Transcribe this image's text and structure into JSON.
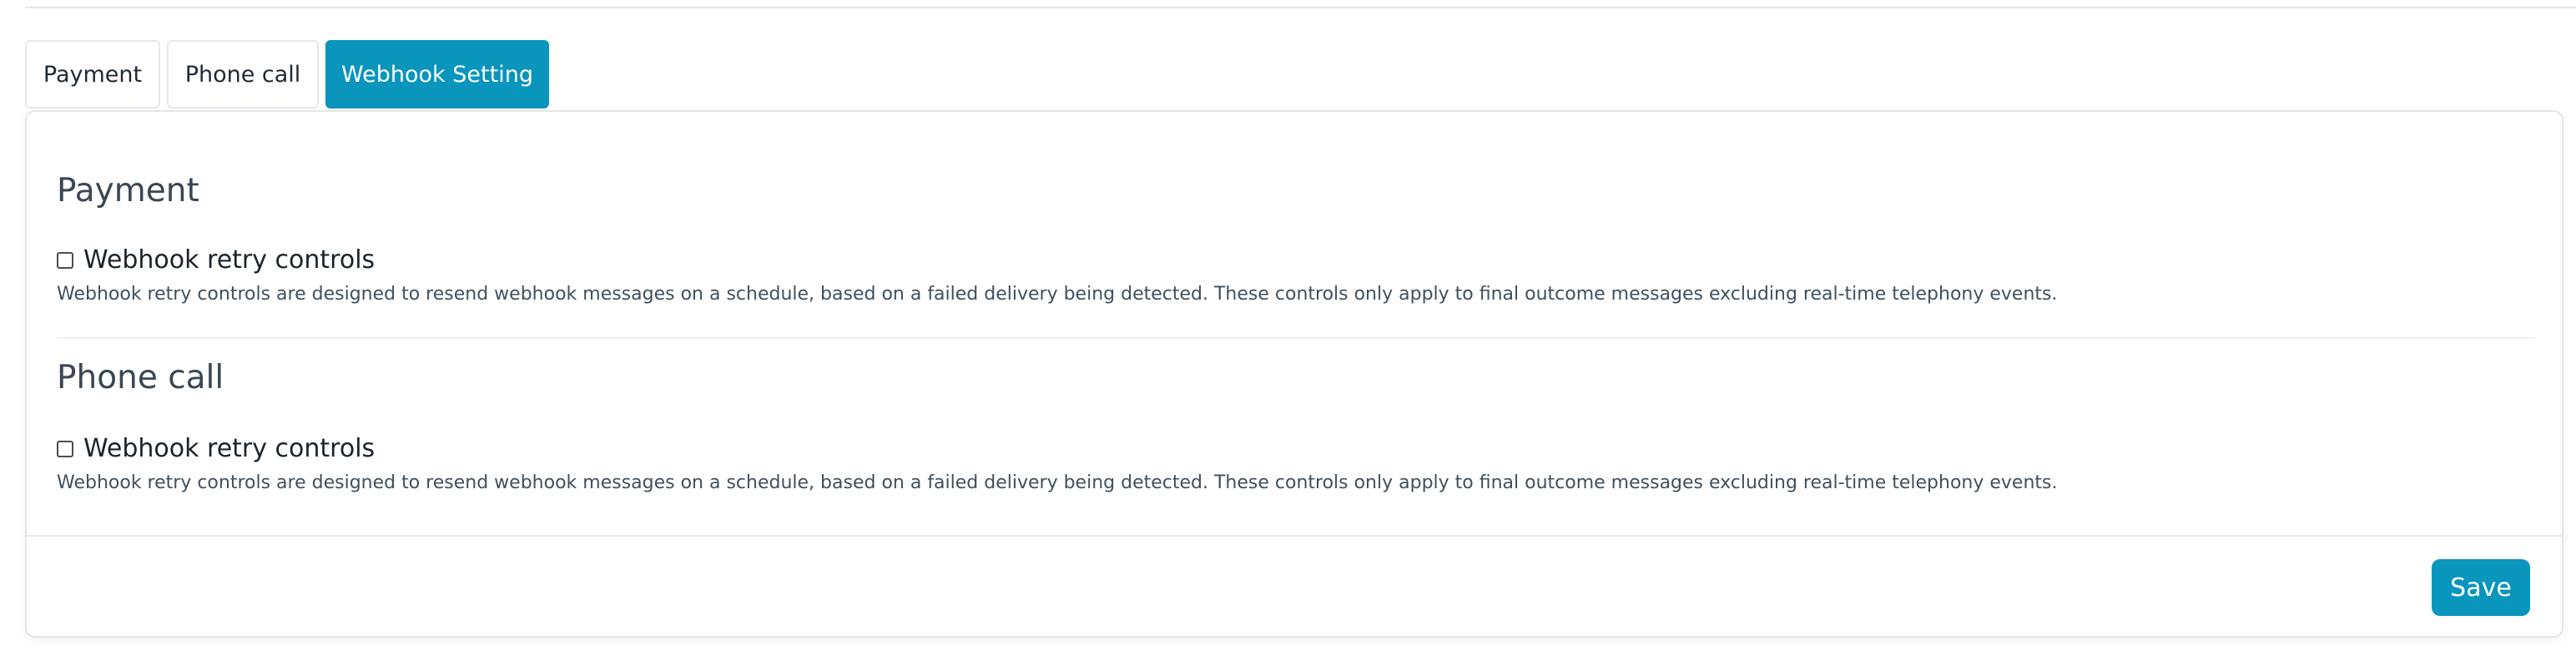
{
  "tabs": [
    {
      "label": "Payment"
    },
    {
      "label": "Phone call"
    },
    {
      "label": "Webhook Setting"
    }
  ],
  "active_tab": "Webhook Setting",
  "sections": [
    {
      "title": "Payment",
      "checkbox_label": "Webhook retry controls",
      "checked": false,
      "description": "Webhook retry controls are designed to resend webhook messages on a schedule, based on a failed delivery being detected. These controls only apply to final outcome messages excluding real-time telephony events."
    },
    {
      "title": "Phone call",
      "checkbox_label": "Webhook retry controls",
      "checked": false,
      "description": "Webhook retry controls are designed to resend webhook messages on a schedule, based on a failed delivery being detected. These controls only apply to final outcome messages excluding real-time telephony events."
    }
  ],
  "footer": {
    "save_label": "Save"
  },
  "colors": {
    "accent": "#0a95bd",
    "border": "#e3e6ea",
    "heading": "#3b4652",
    "text": "#41505e"
  }
}
